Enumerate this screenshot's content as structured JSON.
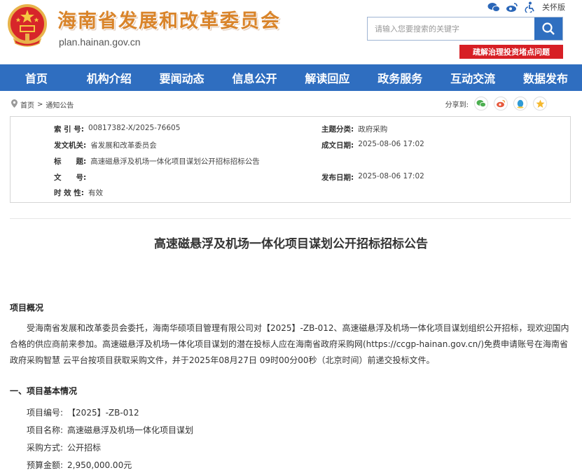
{
  "header": {
    "site_title": "海南省发展和改革委员会",
    "site_url": "plan.hainan.gov.cn",
    "care_mode": "关怀版",
    "search_placeholder": "请输入您要搜索的关键字",
    "red_link": "疏解治理投资堵点问题"
  },
  "nav": [
    "首页",
    "机构介绍",
    "要闻动态",
    "信息公开",
    "解读回应",
    "政务服务",
    "互动交流",
    "数据发布"
  ],
  "breadcrumb": {
    "home": "首页",
    "sep": ">",
    "current": "通知公告"
  },
  "share": {
    "label": "分享到:"
  },
  "meta": {
    "index_key": "索 引 号:",
    "index_val": "00817382-X/2025-76605",
    "category_key": "主题分类:",
    "category_val": "政府采购",
    "issuer_key": "发文机关:",
    "issuer_val": "省发展和改革委员会",
    "created_key": "成文日期:",
    "created_val": "2025-08-06 17:02",
    "title_key": "标　　题:",
    "title_val": "高速磁悬浮及机场一体化项目谋划公开招标招标公告",
    "docno_key": "文　　号:",
    "docno_val": "",
    "published_key": "发布日期:",
    "published_val": "2025-08-06 17:02",
    "validity_key": "时 效 性:",
    "validity_val": "有效"
  },
  "article": {
    "title": "高速磁悬浮及机场一体化项目谋划公开招标招标公告",
    "overview_heading": "项目概况",
    "overview_text": "受海南省发展和改革委员会委托，海南华硕项目管理有限公司对【2025】-ZB-012、高速磁悬浮及机场一体化项目谋划组织公开招标，现欢迎国内合格的供应商前来参加。高速磁悬浮及机场一体化项目谋划的潜在投标人应在海南省政府采购网(https://ccgp-hainan.gov.cn/)免费申请账号在海南省政府采购智慧 云平台按项目获取采购文件，并于2025年08月27日 09时00分00秒（北京时间）前递交投标文件。",
    "basic_heading": "一、项目基本情况",
    "fields": [
      {
        "key": "项目编号:",
        "val": "【2025】-ZB-012"
      },
      {
        "key": "项目名称:",
        "val": "高速磁悬浮及机场一体化项目谋划"
      },
      {
        "key": "采购方式:",
        "val": "公开招标"
      },
      {
        "key": "预算金额:",
        "val": "2,950,000.00元"
      }
    ]
  },
  "colors": {
    "nav_blue": "#2f6ec0",
    "title_orange": "#d9842a",
    "red_link": "#d71f25"
  }
}
